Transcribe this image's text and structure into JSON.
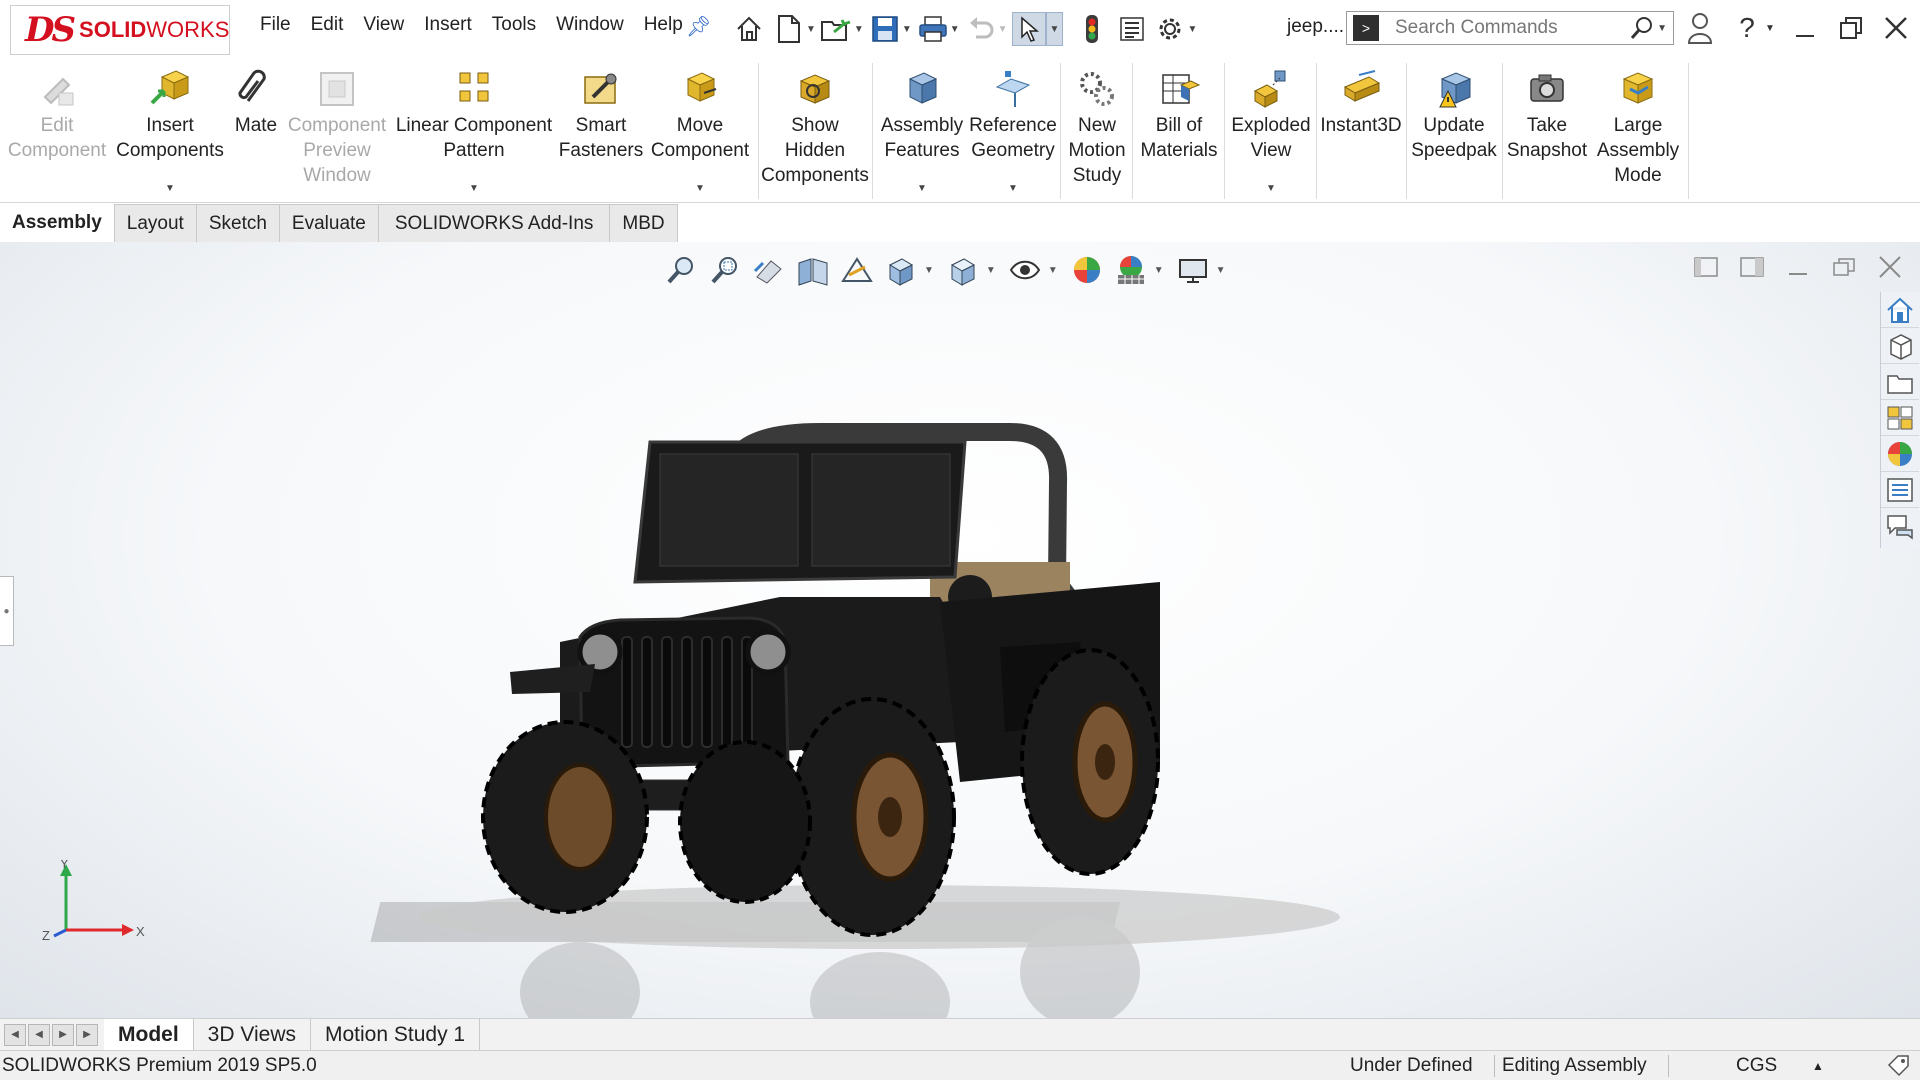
{
  "app": {
    "logo_ds": "DS",
    "logo_name_bold": "SOLID",
    "logo_name_rest": "WORKS",
    "document_name": "jeep...."
  },
  "menu": [
    "File",
    "Edit",
    "View",
    "Insert",
    "Tools",
    "Window",
    "Help"
  ],
  "search": {
    "placeholder": "Search Commands"
  },
  "commands": [
    {
      "label": "Edit\nComponent",
      "icon": "edit-component-icon",
      "enabled": false,
      "dropdown": false
    },
    {
      "label": "Insert\nComponents",
      "icon": "insert-components-icon",
      "enabled": true,
      "dropdown": true
    },
    {
      "label": "Mate",
      "icon": "mate-icon",
      "enabled": true,
      "dropdown": false
    },
    {
      "label": "Component\nPreview\nWindow",
      "icon": "component-preview-icon",
      "enabled": false,
      "dropdown": false
    },
    {
      "label": "Linear Component\nPattern",
      "icon": "linear-pattern-icon",
      "enabled": true,
      "dropdown": true
    },
    {
      "label": "Smart\nFasteners",
      "icon": "smart-fasteners-icon",
      "enabled": true,
      "dropdown": false
    },
    {
      "label": "Move\nComponent",
      "icon": "move-component-icon",
      "enabled": true,
      "dropdown": true
    },
    {
      "label": "Show\nHidden\nComponents",
      "icon": "show-hidden-icon",
      "enabled": true,
      "dropdown": false
    },
    {
      "label": "Assembly\nFeatures",
      "icon": "assembly-features-icon",
      "enabled": true,
      "dropdown": true
    },
    {
      "label": "Reference\nGeometry",
      "icon": "reference-geometry-icon",
      "enabled": true,
      "dropdown": true
    },
    {
      "label": "New\nMotion\nStudy",
      "icon": "motion-study-icon",
      "enabled": true,
      "dropdown": false
    },
    {
      "label": "Bill of\nMaterials",
      "icon": "bom-icon",
      "enabled": true,
      "dropdown": false
    },
    {
      "label": "Exploded\nView",
      "icon": "exploded-view-icon",
      "enabled": true,
      "dropdown": true
    },
    {
      "label": "Instant3D",
      "icon": "instant3d-icon",
      "enabled": true,
      "dropdown": false
    },
    {
      "label": "Update\nSpeedpak",
      "icon": "speedpak-icon",
      "enabled": true,
      "dropdown": false
    },
    {
      "label": "Take\nSnapshot",
      "icon": "snapshot-icon",
      "enabled": true,
      "dropdown": false
    },
    {
      "label": "Large\nAssembly\nMode",
      "icon": "large-assembly-icon",
      "enabled": true,
      "dropdown": false
    }
  ],
  "tabs": [
    {
      "label": "Assembly",
      "active": true
    },
    {
      "label": "Layout",
      "active": false
    },
    {
      "label": "Sketch",
      "active": false
    },
    {
      "label": "Evaluate",
      "active": false
    },
    {
      "label": "SOLIDWORKS Add-Ins",
      "active": false
    },
    {
      "label": "MBD",
      "active": false
    }
  ],
  "triad": {
    "x": "X",
    "y": "Y",
    "z": "Z"
  },
  "bottom_tabs": [
    {
      "label": "Model",
      "active": true
    },
    {
      "label": "3D Views",
      "active": false
    },
    {
      "label": "Motion Study 1",
      "active": false
    }
  ],
  "status": {
    "product": "SOLIDWORKS Premium 2019 SP5.0",
    "definition": "Under Defined",
    "mode": "Editing Assembly",
    "units": "CGS"
  },
  "colors": {
    "brand_red": "#d40f1f",
    "accent_blue": "#2b66c9"
  }
}
